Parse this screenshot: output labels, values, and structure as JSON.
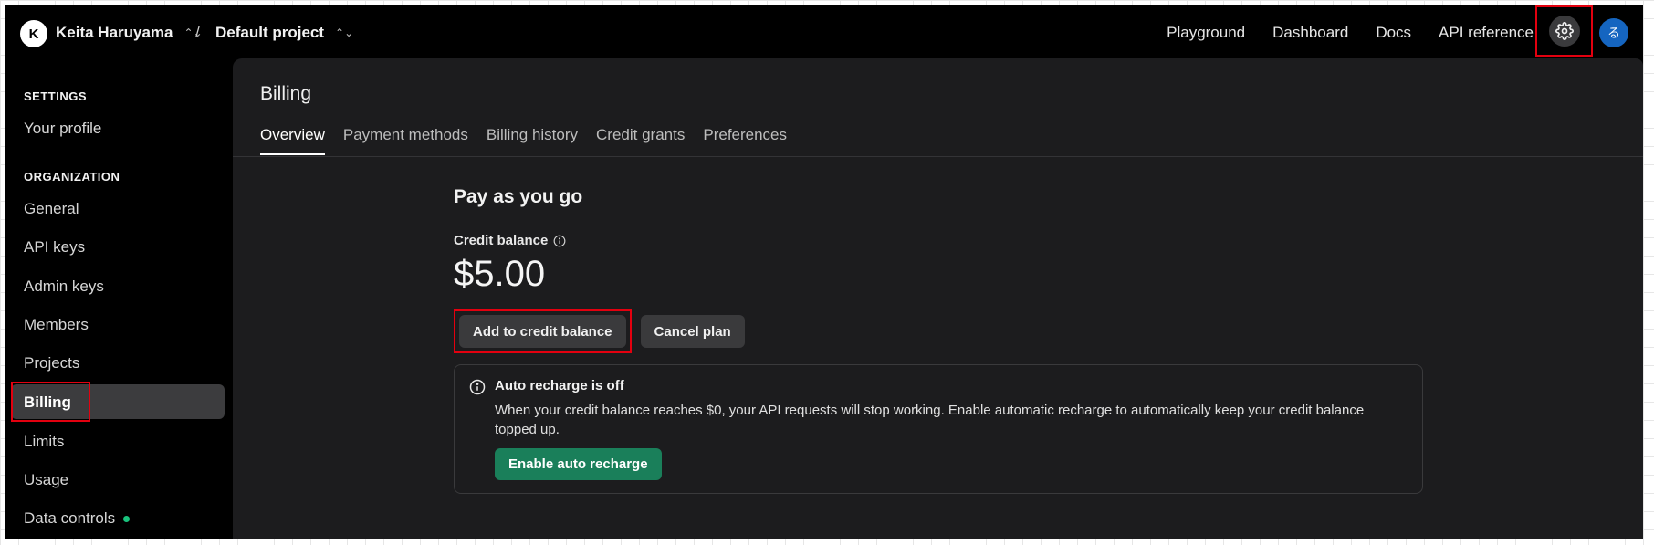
{
  "topbar": {
    "org_initial": "K",
    "org_name": "Keita Haruyama",
    "project_name": "Default project",
    "separator": "/",
    "links": [
      "Playground",
      "Dashboard",
      "Docs",
      "API reference"
    ],
    "user_initial": "る"
  },
  "sidebar": {
    "settings_title": "SETTINGS",
    "profile": "Your profile",
    "org_title": "ORGANIZATION",
    "items": [
      "General",
      "API keys",
      "Admin keys",
      "Members",
      "Projects",
      "Billing",
      "Limits",
      "Usage",
      "Data controls"
    ],
    "active_item": "Billing"
  },
  "main": {
    "title": "Billing",
    "tabs": [
      "Overview",
      "Payment methods",
      "Billing history",
      "Credit grants",
      "Preferences"
    ],
    "active_tab": "Overview",
    "plan_title": "Pay as you go",
    "credit_label": "Credit balance",
    "balance": "$5.00",
    "add_credit_label": "Add to credit balance",
    "cancel_label": "Cancel plan",
    "notice": {
      "title": "Auto recharge is off",
      "text": "When your credit balance reaches $0, your API requests will stop working. Enable automatic recharge to automatically keep your credit balance topped up.",
      "button": "Enable auto recharge"
    }
  },
  "colors": {
    "background": "#000000",
    "panel": "#1c1c1e",
    "highlight_box": "#e3000f",
    "green_button": "#1a7f5a",
    "status_dot": "#19c37d",
    "avatar_blue": "#1565c0"
  }
}
